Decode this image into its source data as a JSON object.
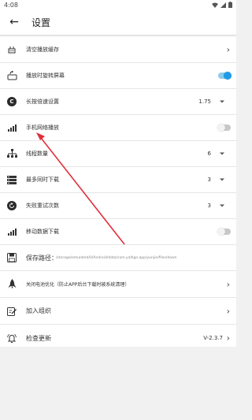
{
  "status": {
    "time": "4:08"
  },
  "header": {
    "title": "设置"
  },
  "rows": {
    "clear_cache": {
      "label": "清空播放缓存"
    },
    "rotate": {
      "label": "播放时旋转屏幕"
    },
    "speed": {
      "label": "长按倍速设置",
      "value": "1.75"
    },
    "mobile_play": {
      "label": "手机网络播放"
    },
    "threads": {
      "label": "线程数量",
      "value": "6"
    },
    "max_downloads": {
      "label": "最多同时下载",
      "value": "3"
    },
    "retry": {
      "label": "失败重试次数",
      "value": "3"
    },
    "mobile_download": {
      "label": "移动数据下载"
    },
    "save_path": {
      "label": "保存路径：",
      "path": "/storage/emulated/0/Android/data/com.yalhgo.app/yunjie/files/down"
    },
    "battery": {
      "label": "关闭电池优化（防止APP后台下载时被系统清理）"
    },
    "join": {
      "label": "加入组织"
    },
    "update": {
      "label": "检查更新",
      "value": "V-2.3.7"
    }
  },
  "toggles": {
    "rotate": true,
    "mobile_play": false,
    "mobile_download": false
  },
  "colors": {
    "accent": "#1e9be6",
    "annotation_arrow": "#e0303a"
  }
}
